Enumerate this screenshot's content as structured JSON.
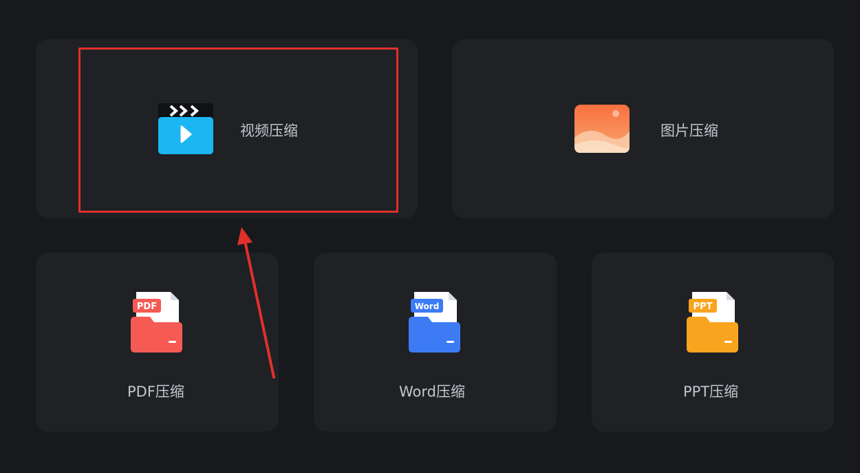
{
  "cards": {
    "video": {
      "label": "视频压缩",
      "icon": "video-clapperboard-icon"
    },
    "image": {
      "label": "图片压缩",
      "icon": "image-landscape-icon"
    },
    "pdf": {
      "label": "PDF压缩",
      "icon": "pdf-folder-icon",
      "badge": "PDF"
    },
    "word": {
      "label": "Word压缩",
      "icon": "word-folder-icon",
      "badge": "Word"
    },
    "ppt": {
      "label": "PPT压缩",
      "icon": "ppt-folder-icon",
      "badge": "PPT"
    }
  },
  "annotation": {
    "highlight_color": "#e1302a",
    "highlighted_card": "video"
  },
  "colors": {
    "background": "#17191c",
    "card": "#1f2125",
    "label": "#c3c6cc",
    "video_accent": "#1cb6f3",
    "image_accent": "#f77e4a",
    "pdf_accent": "#f55a55",
    "word_accent": "#3d7bf5",
    "ppt_accent": "#f8a41f"
  }
}
